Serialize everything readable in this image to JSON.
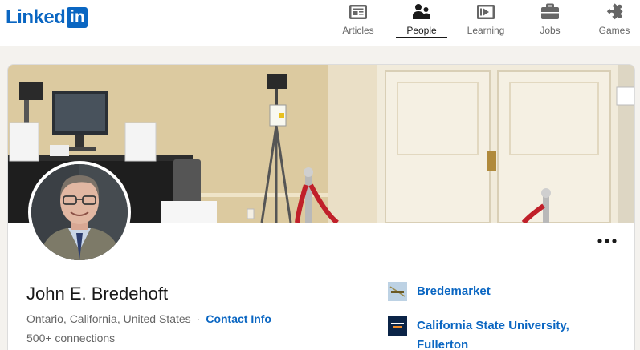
{
  "brand": {
    "wordmark": "Linked",
    "badge": "in",
    "color": "#0a66c2"
  },
  "nav": {
    "items": [
      {
        "label": "Articles",
        "icon": "articles-icon"
      },
      {
        "label": "People",
        "icon": "people-icon",
        "active": true
      },
      {
        "label": "Learning",
        "icon": "learning-icon"
      },
      {
        "label": "Jobs",
        "icon": "briefcase-icon"
      },
      {
        "label": "Games",
        "icon": "puzzle-icon"
      }
    ]
  },
  "profile": {
    "name": "John E. Bredehoft",
    "location": "Ontario, California, United States",
    "separator": "·",
    "contact_label": "Contact Info",
    "connections": "500+ connections",
    "more_label": "•••",
    "organizations": [
      {
        "name": "Bredemarket",
        "logo_text": "Bredemarket"
      },
      {
        "name": "California State University, Fullerton",
        "logo_text": "Cal State Fullerton"
      }
    ]
  }
}
